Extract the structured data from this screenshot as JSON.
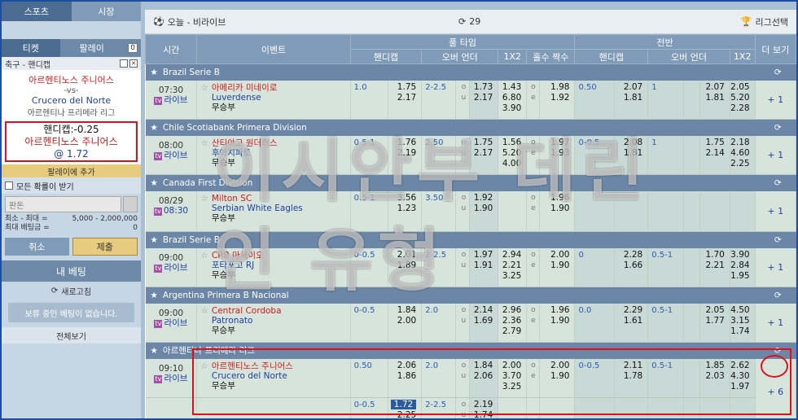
{
  "nav": {
    "sports": "스포츠",
    "market": "시장"
  },
  "slip_tabs": {
    "ticket": "티켓",
    "parlay": "팔레이",
    "parlay_count": "0"
  },
  "slip": {
    "header": "축구 - 핸디캡",
    "home": "아르헨티노스 주니어스",
    "vs": "-vs-",
    "away": "Crucero del Norte",
    "league": "아르헨티나 프리메라 리그",
    "sel_line1": "핸디캡:-0.25",
    "sel_line2": "아르헨티노스 주니어스",
    "sel_line3": "@  1.72",
    "add_parlay": "팔레이에 추가",
    "accept_all": "모든 확률이 받기",
    "stake_placeholder": "판돈",
    "min_max_label": "최소 - 최대 =",
    "min_max_value": "5,000 - 2,000,000",
    "max_payout_label": "최대 배팅금 =",
    "max_payout_value": "0",
    "cancel": "취소",
    "submit": "제출"
  },
  "mybets": {
    "title": "내 베팅",
    "refresh": "새로고침",
    "pending": "보류 중인 베팅이 없습니다.",
    "view_all": "전체보기"
  },
  "main": {
    "title": "오늘 - 비라이브",
    "count": "29",
    "league_select": "리그선택"
  },
  "headers": {
    "time": "시간",
    "event": "이벤트",
    "full_time": "풀 타임",
    "half": "전반",
    "more": "더 보기",
    "handicap": "핸디캡",
    "over_under": "오버 언더",
    "x12": "1X2",
    "odd_even": "홀수 짝수"
  },
  "rows": [
    {
      "league": "Brazil Serie B",
      "time1": "07:30",
      "time2": "라이브",
      "home": "아메리카 미네이로",
      "away": "Luverdense",
      "draw": "무승부",
      "hc": "1.0",
      "hc_h": "1.75",
      "hc_a": "2.17",
      "ou": "2-2.5",
      "ou_o": "1.73",
      "ou_u": "2.17",
      "x1": "1.43",
      "x2": "6.80",
      "x3": "3.90",
      "oe_o": "1.98",
      "oe_e": "1.92",
      "h_hc": "0.50",
      "h_hc_h": "2.07",
      "h_hc_a": "1.81",
      "h_ou": "1",
      "h_ou_o": "2.07",
      "h_ou_u": "1.81",
      "h_x1": "2.05",
      "h_x2": "5.20",
      "h_x3": "2.28",
      "more": "1"
    },
    {
      "league": "Chile Scotiabank Primera Division",
      "time1": "08:00",
      "time2": "라이브",
      "home": "산티아고 원더러스",
      "away": "후아치파토",
      "draw": "무승부",
      "hc": "0.5-1",
      "hc_h": "1.76",
      "hc_a": "2.19",
      "ou": "2.50",
      "ou_o": "1.75",
      "ou_u": "2.17",
      "x1": "1.56",
      "x2": "5.20",
      "x3": "4.00",
      "oe_o": "1.97",
      "oe_e": "1.93",
      "h_hc": "0-0.5",
      "h_hc_h": "2.08",
      "h_hc_a": "1.81",
      "h_ou": "1",
      "h_ou_o": "1.75",
      "h_ou_u": "2.14",
      "h_x1": "2.18",
      "h_x2": "4.60",
      "h_x3": "2.25",
      "more": "1"
    },
    {
      "league": "Canada First Division",
      "time1": "08/29",
      "time2": "08:30",
      "home": "Milton SC",
      "away": "Serbian White Eagles",
      "draw": "무승부",
      "hc": "0.5-1",
      "hc_h": "3.56",
      "hc_a": "1.23",
      "ou": "3.50",
      "ou_o": "1.92",
      "ou_u": "1.90",
      "x1": "",
      "x2": "",
      "x3": "",
      "oe_o": "1.96",
      "oe_e": "1.90",
      "h_hc": "",
      "h_hc_h": "",
      "h_hc_a": "",
      "h_ou": "",
      "h_ou_o": "",
      "h_ou_u": "",
      "h_x1": "",
      "h_x2": "",
      "h_x3": "",
      "more": "1"
    },
    {
      "league": "Brazil Serie B",
      "time1": "09:00",
      "time2": "라이브",
      "home": "CRB 마세이오",
      "away": "포타포고 RJ",
      "draw": "무승부",
      "hc": "0-0.5",
      "hc_h": "2.01",
      "hc_a": "1.89",
      "ou": "2-2.5",
      "ou_o": "1.97",
      "ou_u": "1.91",
      "x1": "2.94",
      "x2": "2.21",
      "x3": "3.25",
      "oe_o": "2.00",
      "oe_e": "1.90",
      "h_hc": "0",
      "h_hc_h": "2.28",
      "h_hc_a": "1.66",
      "h_ou": "0.5-1",
      "h_ou_o": "1.70",
      "h_ou_u": "2.21",
      "h_x1": "3.90",
      "h_x2": "2.84",
      "h_x3": "1.95",
      "more": "1"
    },
    {
      "league": "Argentina Primera B Nacional",
      "time1": "09:00",
      "time2": "라이브",
      "home": "Central Cordoba",
      "away": "Patronato",
      "draw": "무승부",
      "hc": "0-0.5",
      "hc_h": "1.84",
      "hc_a": "2.00",
      "ou": "2.0",
      "ou_o": "2.14",
      "ou_u": "1.69",
      "x1": "2.96",
      "x2": "2.36",
      "x3": "2.79",
      "oe_o": "1.96",
      "oe_e": "1.90",
      "h_hc": "0.0",
      "h_hc_h": "2.29",
      "h_hc_a": "1.61",
      "h_ou": "0.5-1",
      "h_ou_o": "2.05",
      "h_ou_u": "1.77",
      "h_x1": "4.50",
      "h_x2": "3.15",
      "h_x3": "1.74",
      "more": "1"
    },
    {
      "league": "아르헨티나 프리메라 리그",
      "time1": "09:10",
      "time2": "라이브",
      "home": "아르헨티노스 주니어스",
      "away": "Crucero del Norte",
      "draw": "무승부",
      "hc": "0.50",
      "hc_h": "2.06",
      "hc_a": "1.86",
      "ou": "2.0",
      "ou_o": "1.84",
      "ou_u": "2.06",
      "x1": "2.00",
      "x2": "3.70",
      "x3": "3.25",
      "oe_o": "2.00",
      "oe_e": "1.90",
      "h_hc": "0-0.5",
      "h_hc_h": "2.11",
      "h_hc_a": "1.78",
      "h_ou": "0.5-1",
      "h_ou_o": "1.85",
      "h_ou_u": "2.03",
      "h_x1": "2.62",
      "h_x2": "4.30",
      "h_x3": "1.97",
      "more": "6",
      "alt_hc": "0-0.5",
      "alt_hc_h": "1.72",
      "alt_hc_a": "2.25",
      "alt_ou": "2-2.5",
      "alt_ou_o": "2.19",
      "alt_ou_u": "1.74"
    }
  ],
  "labels": {
    "over": "o",
    "under": "u",
    "even": "e",
    "more_prefix": "+"
  },
  "watermark": "이시안부 데린인 유형"
}
